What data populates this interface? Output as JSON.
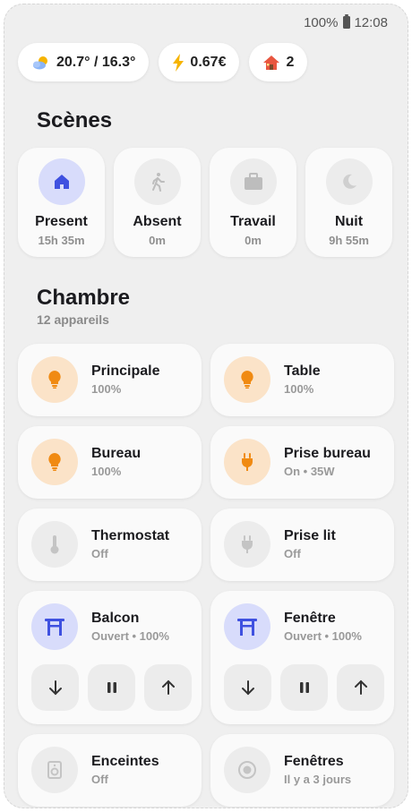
{
  "status_bar": {
    "battery": "100%",
    "time": "12:08"
  },
  "chips": [
    {
      "icon": "weather-partly-cloudy-icon",
      "label": "20.7° / 16.3°"
    },
    {
      "icon": "lightning-icon",
      "label": "0.67€"
    },
    {
      "icon": "house-icon",
      "label": "2"
    }
  ],
  "scenes": {
    "title": "Scènes",
    "items": [
      {
        "name": "Present",
        "time": "15h 35m",
        "icon": "home-icon",
        "active": true
      },
      {
        "name": "Absent",
        "time": "0m",
        "icon": "walking-icon",
        "active": false
      },
      {
        "name": "Travail",
        "time": "0m",
        "icon": "briefcase-icon",
        "active": false
      },
      {
        "name": "Nuit",
        "time": "9h 55m",
        "icon": "moon-icon",
        "active": false
      }
    ]
  },
  "room": {
    "title": "Chambre",
    "subtitle": "12 appareils",
    "devices": [
      {
        "name": "Principale",
        "state": "100%",
        "icon": "bulb-icon"
      },
      {
        "name": "Table",
        "state": "100%",
        "icon": "bulb-icon"
      },
      {
        "name": "Bureau",
        "state": "100%",
        "icon": "bulb-icon"
      },
      {
        "name": "Prise bureau",
        "state": "On • 35W",
        "icon": "plug-icon"
      },
      {
        "name": "Thermostat",
        "state": "Off",
        "icon": "thermometer-icon"
      },
      {
        "name": "Prise lit",
        "state": "Off",
        "icon": "plug-icon"
      },
      {
        "name": "Balcon",
        "state": "Ouvert • 100%",
        "icon": "shutter-icon"
      },
      {
        "name": "Fenêtre",
        "state": "Ouvert • 100%",
        "icon": "shutter-icon"
      },
      {
        "name": "Enceintes",
        "state": "Off",
        "icon": "speaker-icon"
      },
      {
        "name": "Fenêtres",
        "state": "Il y a 3 jours",
        "icon": "sensor-icon"
      }
    ]
  },
  "colors": {
    "accent": "#3f51e0",
    "warm": "#f08a12",
    "inactive": "#bdbdbd"
  }
}
